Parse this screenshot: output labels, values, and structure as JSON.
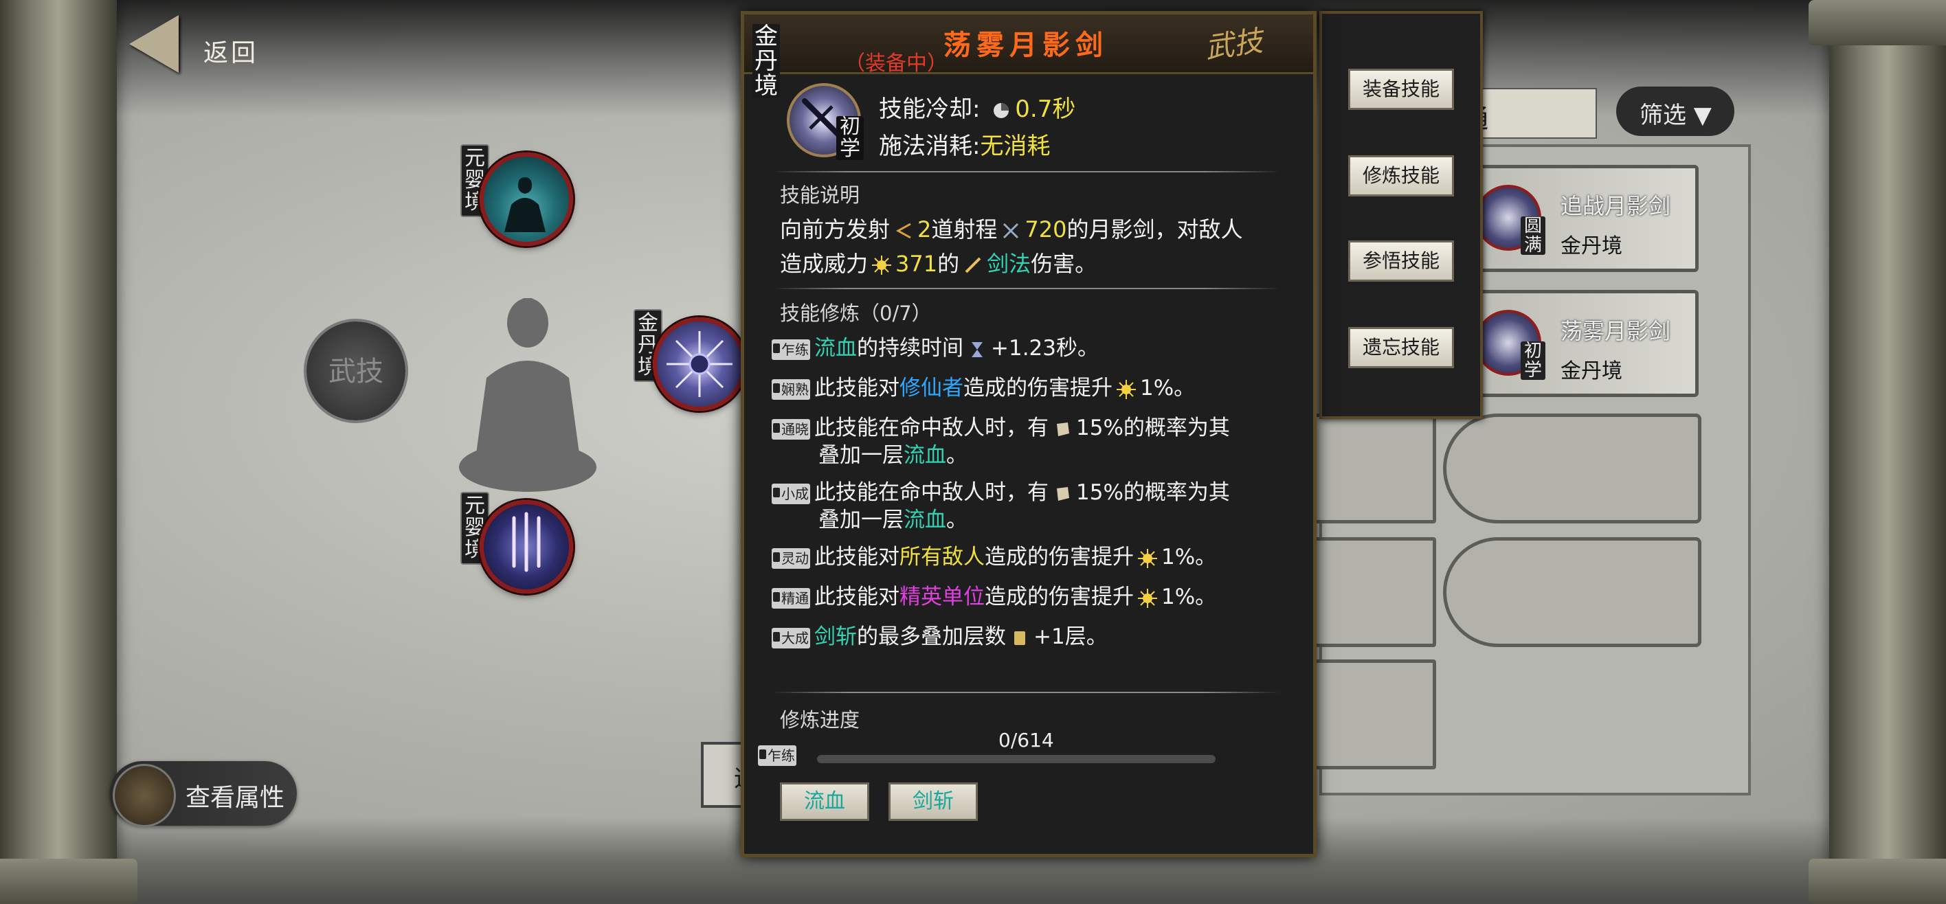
{
  "nav": {
    "back_label": "返回"
  },
  "tree": {
    "wuji_center": "武技",
    "nodes": [
      {
        "realm": "元婴境",
        "name": "元婴境"
      },
      {
        "realm": "金丹境",
        "name": "金丹境"
      },
      {
        "realm": "元婴境",
        "name": "元婴境"
      }
    ]
  },
  "view_attr_label": "查看属性",
  "right_panel": {
    "tab_label": "神通",
    "filter_label": "筛选 ▼",
    "cards": [
      {
        "name": "追战月影剑",
        "realm": "金丹境",
        "grade": "圆满"
      },
      {
        "name": "荡雾月影剑",
        "realm": "金丹境",
        "grade": "初学"
      }
    ]
  },
  "actions": [
    "装备技能",
    "修炼技能",
    "参悟技能",
    "遗忘技能"
  ],
  "popup": {
    "realm": "金丹境",
    "equipped": "（装备中）",
    "title": "荡雾月影剑",
    "stamp": "武技",
    "grade": "初学",
    "cooldown_label": "技能冷却:",
    "cooldown_value": "0.7秒",
    "cost_label": "施法消耗:",
    "cost_value": "无消耗",
    "desc_title": "技能说明",
    "desc": {
      "p1": "向前方发射",
      "count": "2",
      "p2": "道射程",
      "range": "720",
      "p3": "的月影剑，对敌人",
      "p4": "造成威力",
      "power": "371",
      "p5": "的",
      "type": "剑法",
      "p6": "伤害。"
    },
    "train_title": "技能修炼（0/7）",
    "train": [
      {
        "badge": "乍练",
        "pre": "",
        "hl": "流血",
        "hl_class": "cyan",
        "post": "的持续时间",
        "val": "+1.23秒。",
        "line2": ""
      },
      {
        "badge": "娴熟",
        "pre": "此技能对",
        "hl": "修仙者",
        "hl_class": "blue",
        "post": "造成的伤害提升",
        "val": "1%。",
        "line2": ""
      },
      {
        "badge": "通晓",
        "pre": "此技能在命中敌人时，有",
        "hl": "",
        "hl_class": "",
        "post": "",
        "val": "15%的概率为其",
        "line2": "叠加一层",
        "line2_hl": "流血",
        "line2_end": "。"
      },
      {
        "badge": "小成",
        "pre": "此技能在命中敌人时，有",
        "hl": "",
        "hl_class": "",
        "post": "",
        "val": "15%的概率为其",
        "line2": "叠加一层",
        "line2_hl": "流血",
        "line2_end": "。"
      },
      {
        "badge": "灵动",
        "pre": "此技能对",
        "hl": "所有敌人",
        "hl_class": "yellow",
        "post": "造成的伤害提升",
        "val": "1%。",
        "line2": ""
      },
      {
        "badge": "精通",
        "pre": "此技能对",
        "hl": "精英单位",
        "hl_class": "magenta",
        "post": "造成的伤害提升",
        "val": "1%。",
        "line2": ""
      },
      {
        "badge": "大成",
        "pre": "",
        "hl": "剑斩",
        "hl_class": "cyan",
        "post": "的最多叠加层数",
        "val": "+1层。",
        "line2": ""
      }
    ],
    "progress_title": "修炼进度",
    "progress_badge": "乍练",
    "progress_text": "0/614",
    "progress_fraction": 0,
    "tags": [
      "流血",
      "剑斩"
    ]
  },
  "behind_button_partial": "追"
}
